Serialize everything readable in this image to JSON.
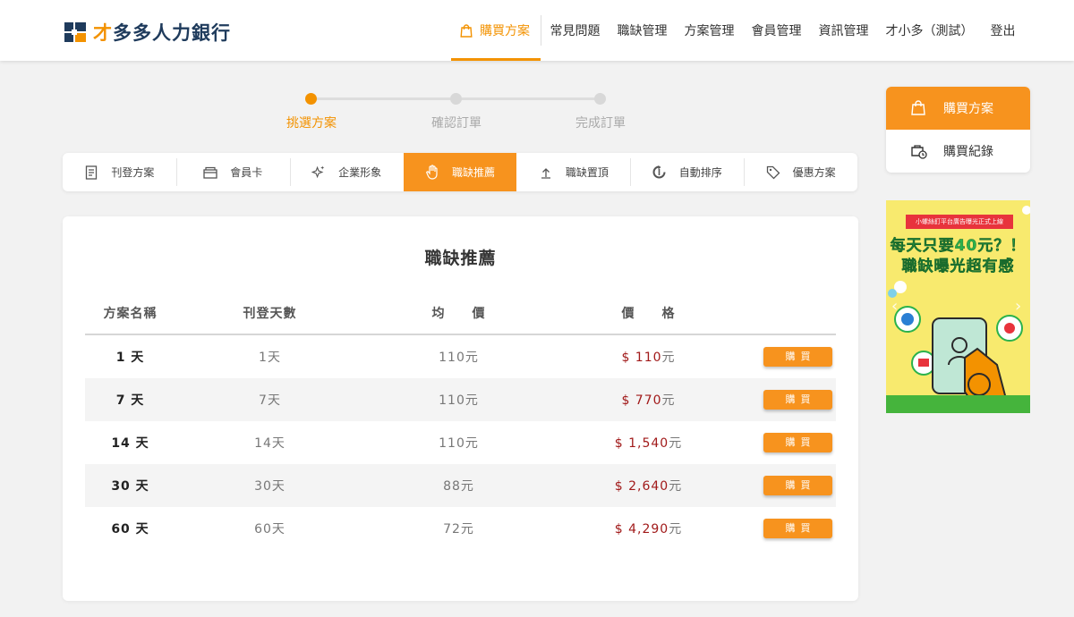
{
  "brand": {
    "name_first": "才",
    "name_rest": "多多人力銀行"
  },
  "nav": {
    "items": [
      {
        "label": "購買方案",
        "active": true
      },
      {
        "label": "常見問題"
      },
      {
        "label": "職缺管理"
      },
      {
        "label": "方案管理"
      },
      {
        "label": "會員管理"
      },
      {
        "label": "資訊管理"
      },
      {
        "label": "才小多（測試）"
      },
      {
        "label": "登出"
      }
    ]
  },
  "steps": [
    {
      "label": "挑選方案",
      "active": true
    },
    {
      "label": "確認訂單"
    },
    {
      "label": "完成訂單"
    }
  ],
  "categories": [
    {
      "label": "刊登方案",
      "icon": "document-icon"
    },
    {
      "label": "會員卡",
      "icon": "card-icon"
    },
    {
      "label": "企業形象",
      "icon": "sparkle-icon"
    },
    {
      "label": "職缺推薦",
      "icon": "hand-icon",
      "active": true
    },
    {
      "label": "職缺置頂",
      "icon": "upload-icon"
    },
    {
      "label": "自動排序",
      "icon": "refresh-icon"
    },
    {
      "label": "優惠方案",
      "icon": "tag-icon"
    }
  ],
  "plan_table": {
    "title": "職缺推薦",
    "columns": [
      "方案名稱",
      "刊登天數",
      "均　　價",
      "價　　格"
    ],
    "buy_label": "購買",
    "rows": [
      {
        "name": "1 天",
        "days": "1天",
        "avg": "110元",
        "price": "$ 110",
        "unit": "元"
      },
      {
        "name": "7 天",
        "days": "7天",
        "avg": "110元",
        "price": "$ 770",
        "unit": "元"
      },
      {
        "name": "14 天",
        "days": "14天",
        "avg": "110元",
        "price": "$ 1,540",
        "unit": "元"
      },
      {
        "name": "30 天",
        "days": "30天",
        "avg": "88元",
        "price": "$ 2,640",
        "unit": "元"
      },
      {
        "name": "60 天",
        "days": "60天",
        "avg": "72元",
        "price": "$ 4,290",
        "unit": "元"
      }
    ]
  },
  "side_menu": {
    "items": [
      {
        "label": "購買方案",
        "active": true
      },
      {
        "label": "購買紀錄"
      }
    ]
  },
  "ad": {
    "banner": "小螺絲釘平台廣告曝光正式上線",
    "line1": "每天只要40元？！",
    "line2": "職缺曝光超有感"
  },
  "colors": {
    "accent": "#f7931e",
    "price": "#a11a1a",
    "brand_dark": "#1f3b5c"
  }
}
